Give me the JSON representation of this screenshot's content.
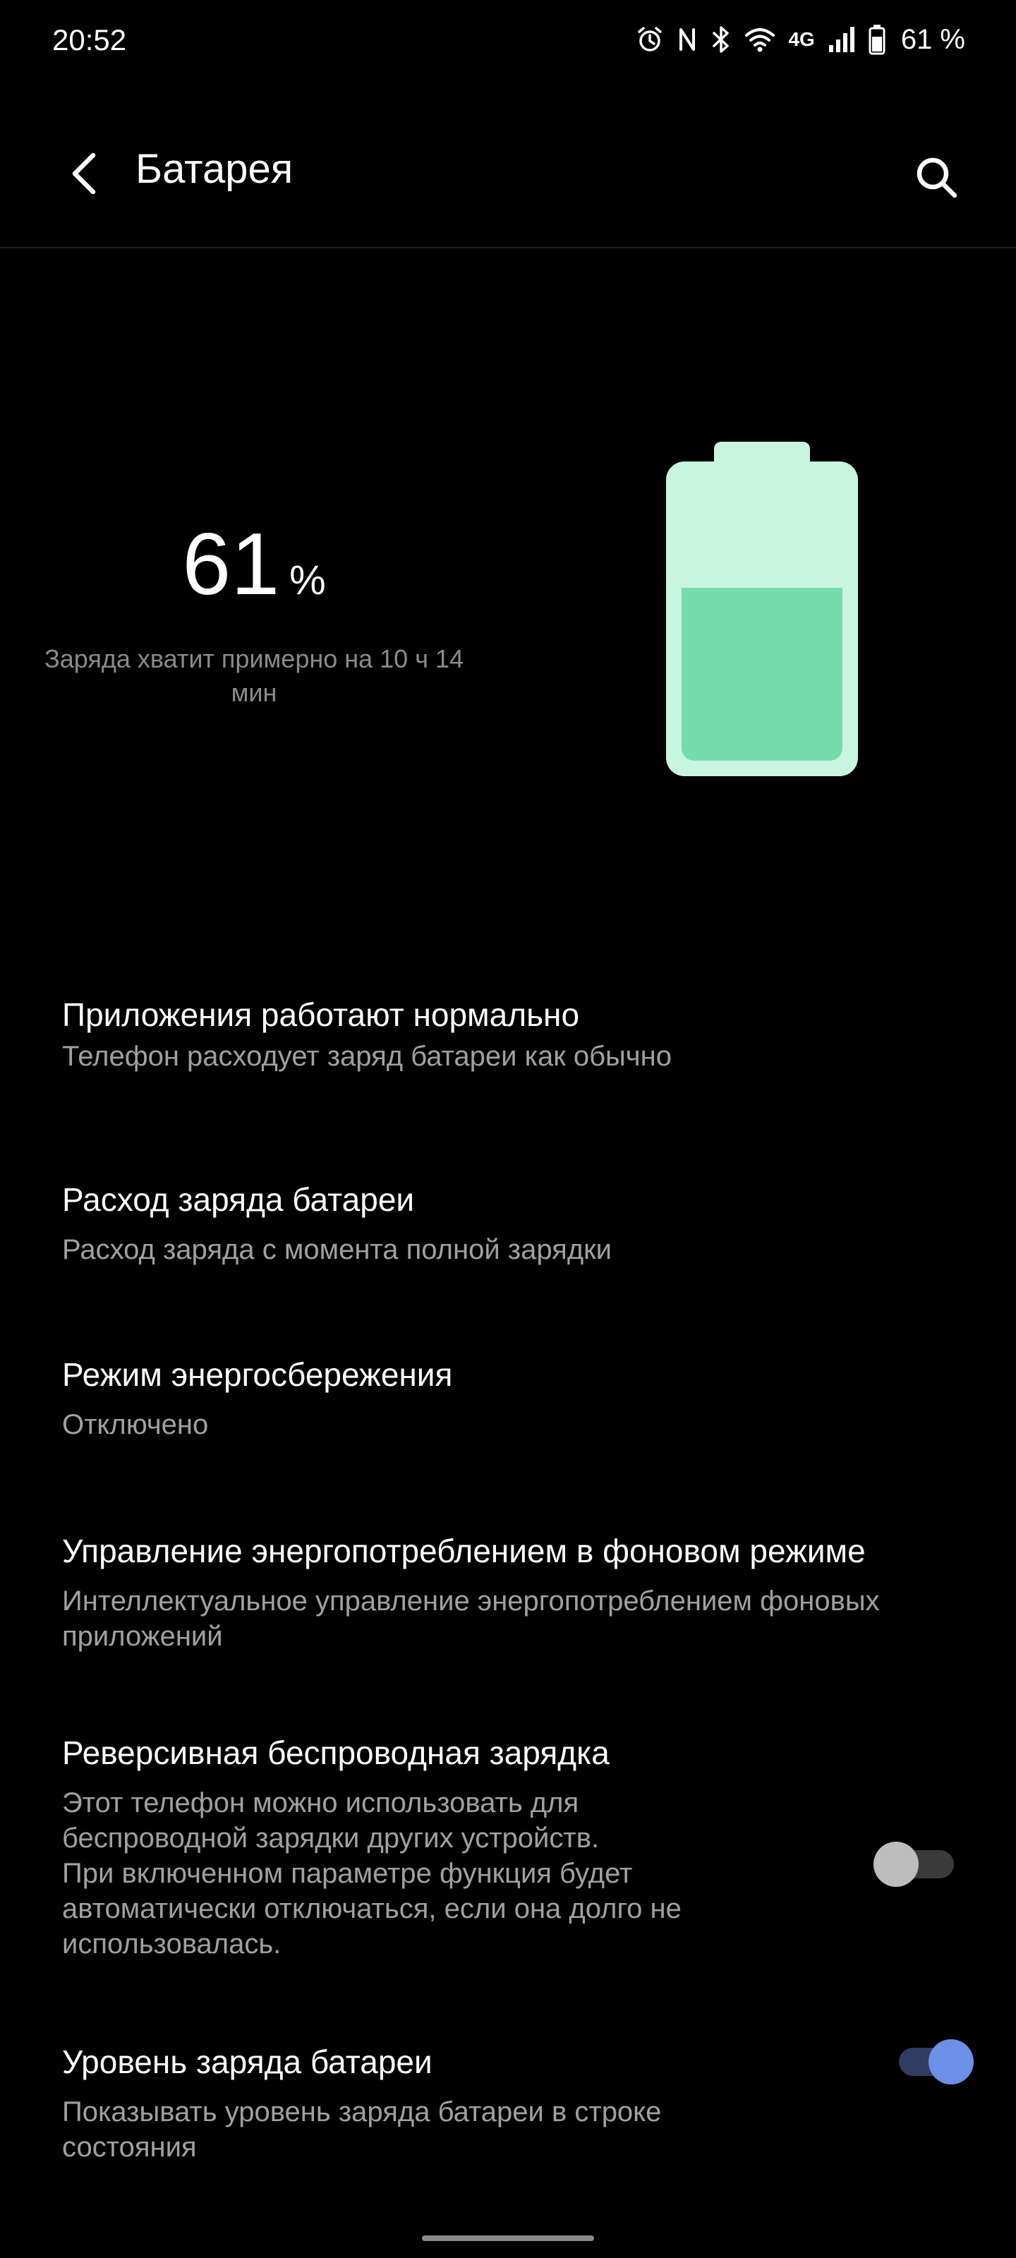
{
  "status_bar": {
    "time": "20:52",
    "network": "4G",
    "battery_text": "61 %",
    "icons": [
      "alarm-icon",
      "nfc-icon",
      "bluetooth-icon",
      "wifi-icon",
      "signal-icon",
      "battery-icon"
    ]
  },
  "app_bar": {
    "title": "Батарея",
    "back_icon": "back-arrow-icon",
    "search_icon": "search-icon"
  },
  "battery": {
    "percent_number": "61",
    "percent_unit": "%",
    "level": 0.61,
    "estimate_line1": "Заряда хватит примерно на 10 ч 14",
    "estimate_line2": "мин",
    "colors": {
      "shell": "#c7f5df",
      "fill": "#76dcad"
    }
  },
  "settings": [
    {
      "title": "Приложения работают нормально",
      "subtitle_lines": [
        "Телефон расходует заряд батареи как обычно"
      ]
    },
    {
      "title": "Расход заряда батареи",
      "subtitle_lines": [
        "Расход заряда с момента полной зарядки"
      ]
    },
    {
      "title": "Режим энергосбережения",
      "subtitle_lines": [
        "Отключено"
      ]
    },
    {
      "title": "Управление энергопотреблением в фоновом режиме",
      "subtitle_lines": [
        "Интеллектуальное управление энергопотреблением фоновых",
        "приложений"
      ]
    },
    {
      "title": "Реверсивная беспроводная зарядка",
      "subtitle_lines": [
        "Этот телефон можно использовать для",
        "беспроводной зарядки других устройств.",
        "При включенном параметре функция будет",
        "автоматически отключаться, если она долго не",
        "использовалась."
      ],
      "toggle": false
    },
    {
      "title": "Уровень заряда батареи",
      "subtitle_lines": [
        "Показывать уровень заряда батареи в строке",
        "состояния"
      ],
      "toggle": true
    }
  ],
  "colors": {
    "background": "#000000",
    "toggle_on": "#6c8fe8",
    "toggle_off": "#bdbdbd"
  }
}
